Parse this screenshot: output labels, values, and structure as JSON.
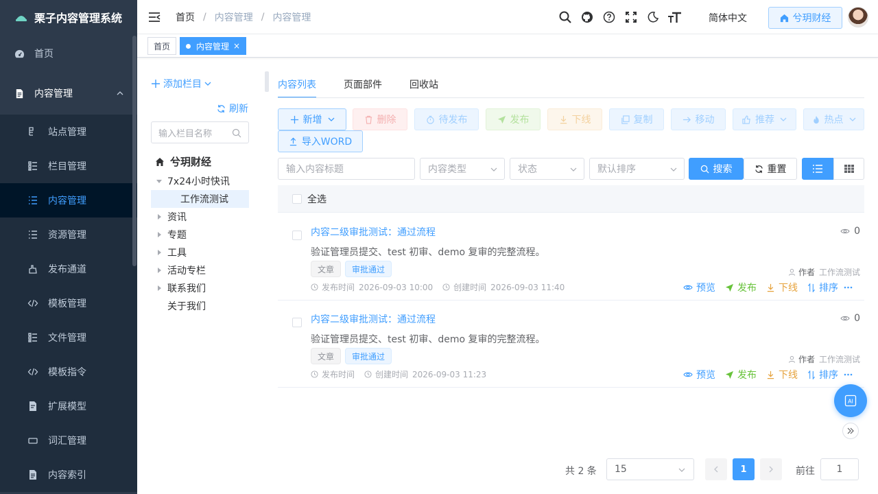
{
  "app": {
    "title": "栗子内容管理系统"
  },
  "sidebar": {
    "home": "首页",
    "group": "内容管理",
    "items": [
      {
        "label": "站点管理",
        "icon": "site-icon"
      },
      {
        "label": "栏目管理",
        "icon": "catalog-icon"
      },
      {
        "label": "内容管理",
        "icon": "list-icon",
        "active": true
      },
      {
        "label": "资源管理",
        "icon": "list-icon"
      },
      {
        "label": "发布通道",
        "icon": "publish-icon"
      },
      {
        "label": "模板管理",
        "icon": "code-icon"
      },
      {
        "label": "文件管理",
        "icon": "catalog-icon"
      },
      {
        "label": "模板指令",
        "icon": "code-icon"
      },
      {
        "label": "扩展模型",
        "icon": "doc-edit-icon"
      },
      {
        "label": "词汇管理",
        "icon": "rect-icon"
      },
      {
        "label": "内容索引",
        "icon": "doc-icon"
      }
    ]
  },
  "header": {
    "breadcrumb": [
      "首页",
      "内容管理",
      "内容管理"
    ],
    "lang": "简体中文",
    "site": "兮玥财经"
  },
  "tags": {
    "home": "首页",
    "current": "内容管理"
  },
  "tree": {
    "add_label": "添加栏目",
    "refresh_label": "刷新",
    "search_placeholder": "输入栏目名称",
    "root": "兮玥财经",
    "nodes": [
      "7x24小时快讯",
      "工作流测试",
      "资讯",
      "专题",
      "工具",
      "活动专栏",
      "联系我们",
      "关于我们"
    ]
  },
  "main": {
    "tabs": [
      "内容列表",
      "页面部件",
      "回收站"
    ],
    "buttons": {
      "add": "新增",
      "delete": "删除",
      "pending": "待发布",
      "publish": "发布",
      "offline": "下线",
      "copy": "复制",
      "move": "移动",
      "recommend": "推荐",
      "hot": "热点",
      "import_word": "导入WORD",
      "search": "搜索",
      "reset": "重置"
    },
    "filters": {
      "title_placeholder": "输入内容标题",
      "type_placeholder": "内容类型",
      "status_placeholder": "状态",
      "sort_placeholder": "默认排序"
    },
    "select_all": "全选"
  },
  "content": [
    {
      "title": "内容二级审批测试：通过流程",
      "summary": "验证管理员提交、test 初审、demo 复审的完整流程。",
      "tags": [
        "文章",
        "审批通过"
      ],
      "publish_label": "发布时间",
      "publish_time": "2026-09-03 10:00",
      "create_label": "创建时间",
      "create_time": "2026-09-03 11:40",
      "views": "0",
      "author_label": "作者",
      "author": "工作流测试",
      "actions": {
        "preview": "预览",
        "publish": "发布",
        "offline": "下线",
        "sort": "排序"
      }
    },
    {
      "title": "内容二级审批测试：通过流程",
      "summary": "验证管理员提交、test 初审、demo 复审的完整流程。",
      "tags": [
        "文章",
        "审批通过"
      ],
      "publish_label": "发布时间",
      "publish_time": "",
      "create_label": "创建时间",
      "create_time": "2026-09-03 11:23",
      "views": "0",
      "author_label": "作者",
      "author": "工作流测试",
      "actions": {
        "preview": "预览",
        "publish": "发布",
        "offline": "下线",
        "sort": "排序"
      }
    }
  ],
  "pagination": {
    "total": "共 2 条",
    "page_size": "15",
    "current": "1",
    "goto_label": "前往",
    "goto_value": "1"
  },
  "colors": {
    "primary": "#409eff",
    "success": "#67c23a",
    "warning": "#e6a23c",
    "sidebar": "#2d3a4b"
  }
}
